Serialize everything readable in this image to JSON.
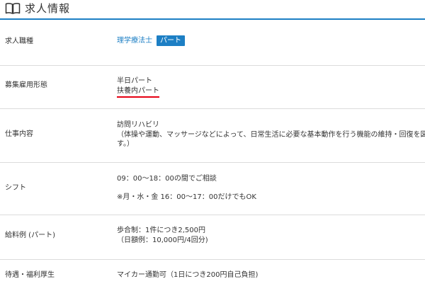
{
  "header": {
    "title": "求人情報",
    "icon": "book-icon"
  },
  "colors": {
    "accent": "#1d7fc4",
    "highlight_underline": "#e60012",
    "divider": "#dcdcdc"
  },
  "rows": [
    {
      "label": "求人職種",
      "job_title_link": "理学療法士",
      "badge": "パート"
    },
    {
      "label": "募集雇用形態",
      "lines": [
        "半日パート",
        "扶養内パート"
      ]
    },
    {
      "label": "仕事内容",
      "lines": [
        "訪問リハビリ",
        "（体操や運動、マッサージなどによって、日常生活に必要な基本動作を行う機能の維持・回復を図りま",
        "す。）"
      ]
    },
    {
      "label": "シフト",
      "lines": [
        "09：00～18：00の間でご相談",
        "※月・水・金 16：00～17：00だけでもOK"
      ]
    },
    {
      "label": "給料例 (パート)",
      "lines": [
        "歩合制：1件につき2,500円",
        "（日額例：10,000円/4回分)"
      ]
    },
    {
      "label": "待遇・福利厚生",
      "lines": [
        "マイカー通勤可（1日につき200円自己負担)"
      ]
    }
  ]
}
